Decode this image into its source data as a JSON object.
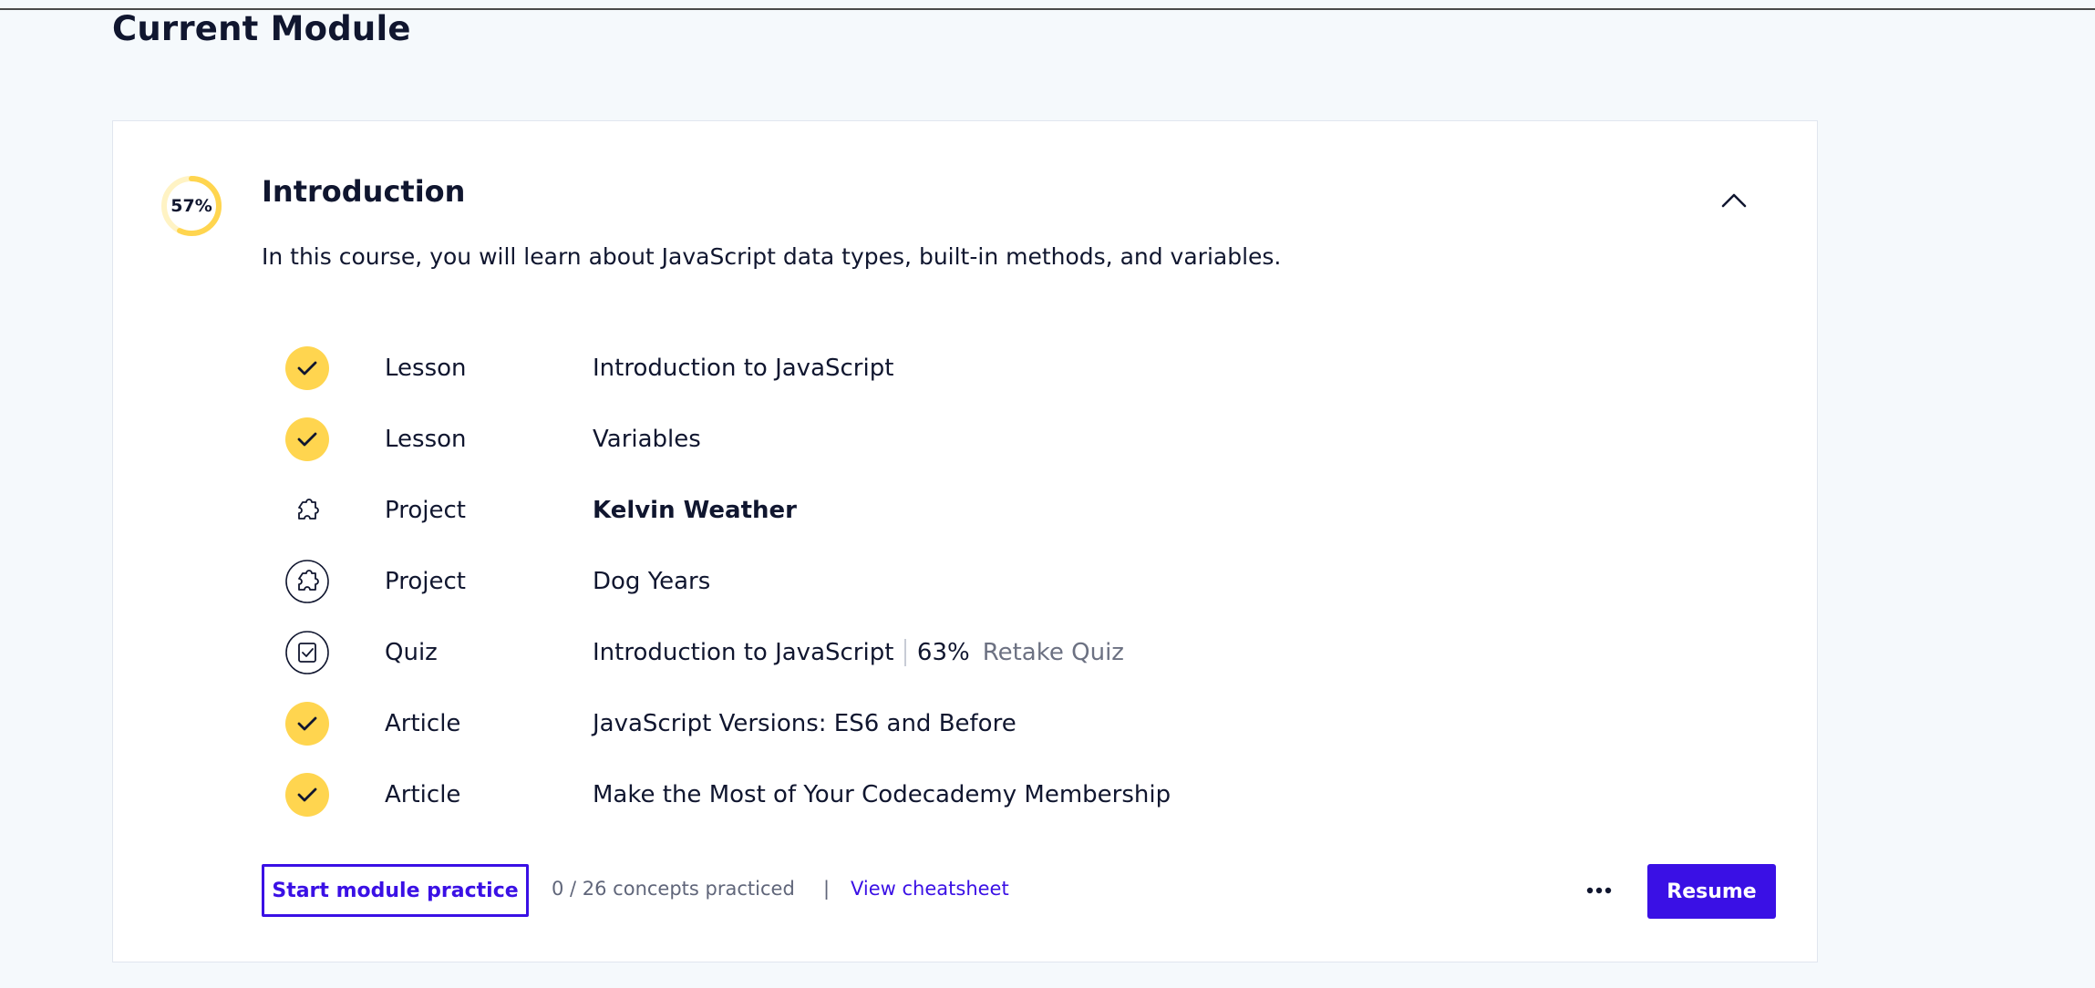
{
  "page": {
    "heading": "Current Module"
  },
  "module": {
    "progress_label": "57%",
    "progress_fraction": 0.57,
    "title": "Introduction",
    "description": "In this course, you will learn about JavaScript data types, built-in methods, and variables.",
    "collapse_icon": "chevron-up-icon"
  },
  "items": [
    {
      "type": "Lesson",
      "name": "Introduction to JavaScript",
      "status": "completed",
      "icon": "check-icon"
    },
    {
      "type": "Lesson",
      "name": "Variables",
      "status": "completed",
      "icon": "check-icon"
    },
    {
      "type": "Project",
      "name": "Kelvin Weather",
      "status": "current",
      "icon": "puzzle-icon"
    },
    {
      "type": "Project",
      "name": "Dog Years",
      "status": "incomplete",
      "icon": "puzzle-icon"
    },
    {
      "type": "Quiz",
      "name": "Introduction to JavaScript",
      "status": "incomplete",
      "icon": "quiz-icon",
      "score": "63%",
      "action": "Retake Quiz"
    },
    {
      "type": "Article",
      "name": "JavaScript Versions: ES6 and Before",
      "status": "completed",
      "icon": "check-icon"
    },
    {
      "type": "Article",
      "name": "Make the Most of Your Codecademy Membership",
      "status": "completed",
      "icon": "check-icon"
    }
  ],
  "footer": {
    "practice_label": "Start module practice",
    "concepts_text": "0 / 26 concepts practiced",
    "separator": "|",
    "cheatsheet_label": "View cheatsheet",
    "more_icon": "more-dots-icon",
    "resume_label": "Resume"
  },
  "colors": {
    "accent": "#3a10e5",
    "completed": "#ffd54f",
    "progress_track": "#fff3c4",
    "text": "#10162f",
    "muted": "#6c7182"
  }
}
